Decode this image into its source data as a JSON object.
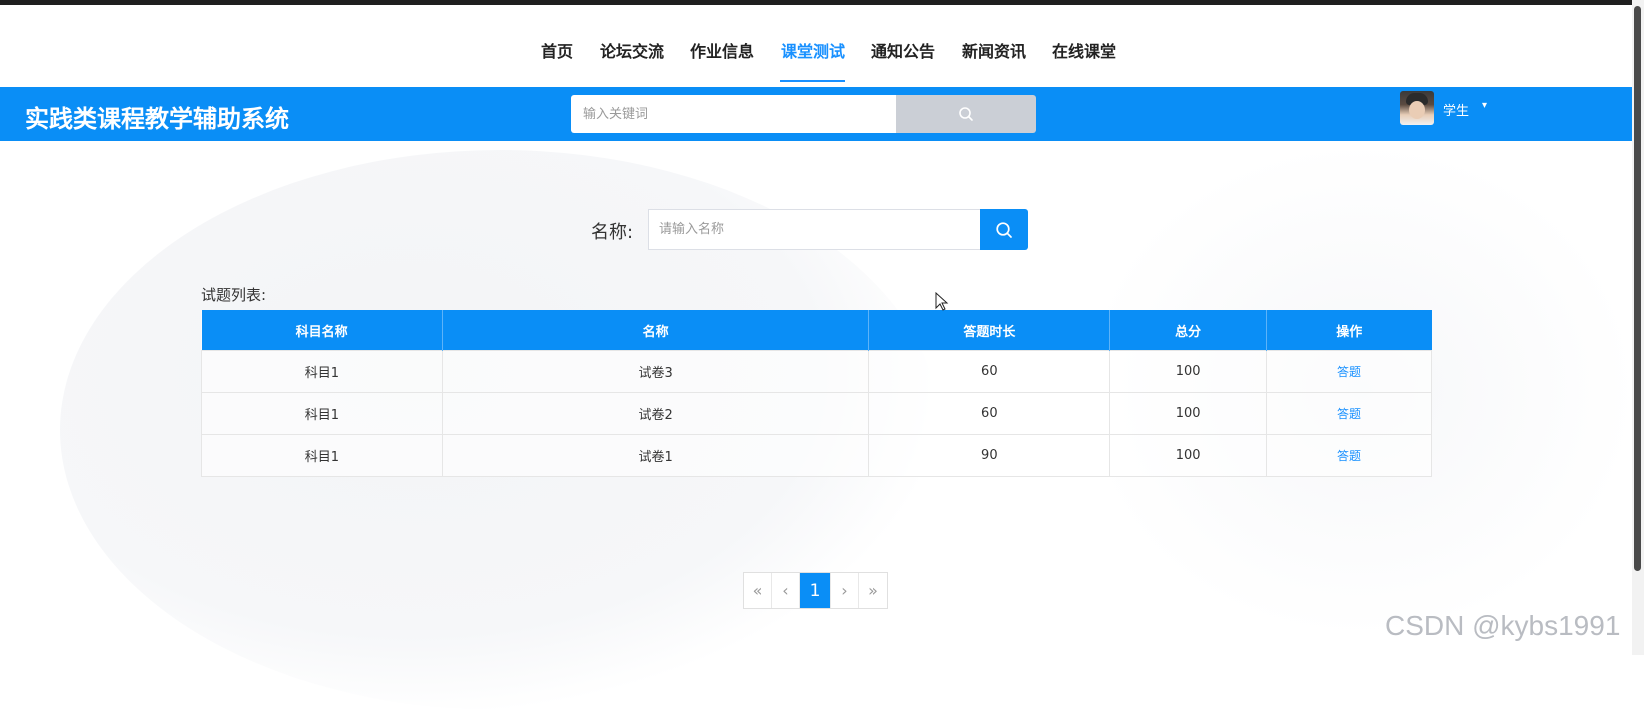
{
  "nav": {
    "items": [
      {
        "label": "首页"
      },
      {
        "label": "论坛交流"
      },
      {
        "label": "作业信息"
      },
      {
        "label": "课堂测试"
      },
      {
        "label": "通知公告"
      },
      {
        "label": "新闻资讯"
      },
      {
        "label": "在线课堂"
      }
    ],
    "active_index": 3
  },
  "header": {
    "title": "实践类课程教学辅助系统",
    "search_placeholder": "输入关键词",
    "user_label": "学生"
  },
  "filter": {
    "label": "名称:",
    "placeholder": "请输入名称"
  },
  "list": {
    "title": "试题列表:",
    "columns": [
      "科目名称",
      "名称",
      "答题时长",
      "总分",
      "操作"
    ],
    "rows": [
      {
        "subject": "科目1",
        "name": "试卷3",
        "duration": "60",
        "score": "100",
        "action": "答题"
      },
      {
        "subject": "科目1",
        "name": "试卷2",
        "duration": "60",
        "score": "100",
        "action": "答题"
      },
      {
        "subject": "科目1",
        "name": "试卷1",
        "duration": "90",
        "score": "100",
        "action": "答题"
      }
    ]
  },
  "pagination": {
    "first": "«",
    "prev": "‹",
    "current": "1",
    "next": "›",
    "last": "»"
  },
  "watermark": "CSDN @kybs1991",
  "colors": {
    "primary": "#0a8ef6",
    "active_nav": "#1890ff"
  },
  "icons": {
    "search": "search-icon",
    "caret": "caret-down-icon"
  }
}
